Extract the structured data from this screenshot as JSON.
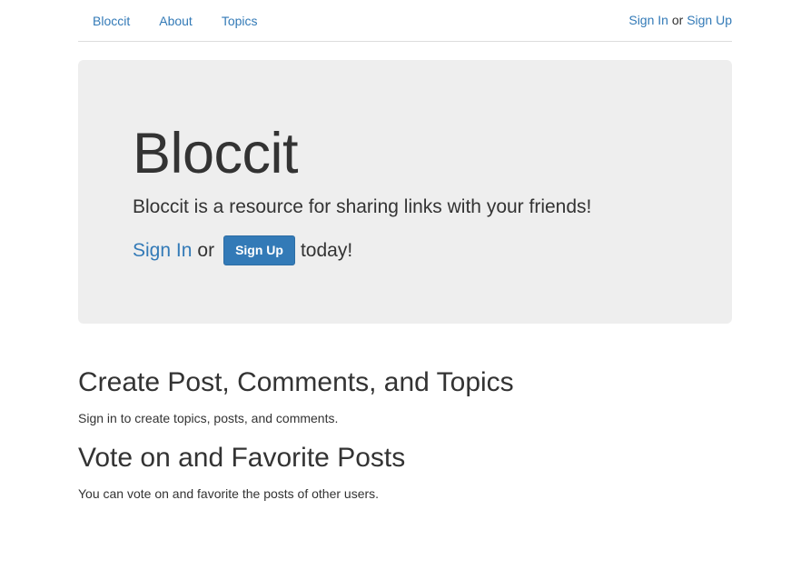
{
  "nav": {
    "links": [
      "Bloccit",
      "About",
      "Topics"
    ],
    "auth": {
      "sign_in": "Sign In",
      "or": "or",
      "sign_up": "Sign Up"
    }
  },
  "jumbotron": {
    "title": "Bloccit",
    "lead": "Bloccit is a resource for sharing links with your friends!",
    "cta": {
      "sign_in": "Sign In",
      "or": "or",
      "sign_up_button": "Sign Up",
      "suffix": "today!"
    }
  },
  "sections": [
    {
      "title": "Create Post, Comments, and Topics",
      "text": "Sign in to create topics, posts, and comments."
    },
    {
      "title": "Vote on and Favorite Posts",
      "text": "You can vote on and favorite the posts of other users."
    }
  ],
  "colors": {
    "link": "#337ab7",
    "jumbotron_bg": "#eeeeee",
    "button_bg": "#337ab7"
  }
}
